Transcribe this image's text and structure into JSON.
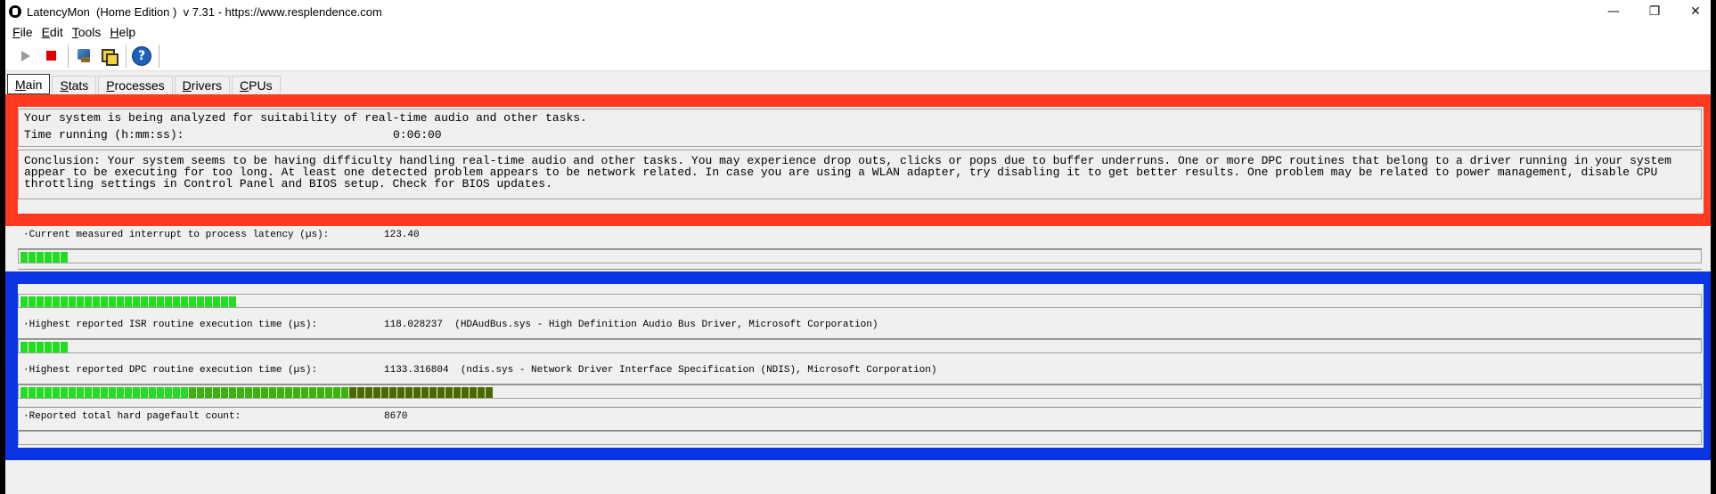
{
  "window": {
    "title": "LatencyMon  (Home Edition )  v 7.31 - https://www.resplendence.com",
    "minimize_glyph": "—",
    "maximize_glyph": "❐",
    "close_glyph": "✕"
  },
  "menu": {
    "file": {
      "accel": "F",
      "rest": "ile"
    },
    "edit": {
      "accel": "E",
      "rest": "dit"
    },
    "tools": {
      "accel": "T",
      "rest": "ools"
    },
    "help": {
      "accel": "H",
      "rest": "elp"
    }
  },
  "toolbar": {
    "icons": [
      "play-icon",
      "stop-icon",
      "analyze-icon",
      "windows-icon",
      "help-icon"
    ],
    "help_glyph": "?"
  },
  "tabs": [
    {
      "accel": "M",
      "rest": "ain",
      "active": true
    },
    {
      "accel": "S",
      "rest": "tats",
      "active": false
    },
    {
      "accel": "P",
      "rest": "rocesses",
      "active": false
    },
    {
      "accel": "D",
      "rest": "rivers",
      "active": false
    },
    {
      "accel": "C",
      "rest": "PUs",
      "active": false
    }
  ],
  "status": {
    "line": "Your system is being analyzed for suitability of real-time audio and other tasks.",
    "time_label": "Time running (h:mm:ss):",
    "time_value": "0:06:00",
    "conclusion": "Conclusion: Your system seems to be having difficulty handling real-time audio and other tasks. You may experience drop outs, clicks or pops due to buffer underruns. One or more DPC routines that belong to a driver running in your system appear to be executing for too long. At least one detected problem appears to be network related. In case you are using a WLAN adapter, try disabling it to get better results. One problem may be related to power management, disable CPU throttling settings in Control Panel and BIOS setup. Check for BIOS updates."
  },
  "metrics": {
    "interrupt": {
      "label": "·Current measured interrupt to process latency (µs):",
      "value": "123.40",
      "bar_segments": 6
    },
    "unlabeled_bar_segments": 27,
    "isr": {
      "label": "·Highest reported ISR routine execution time (µs):",
      "value": "118.028237  (HDAudBus.sys - High Definition Audio Bus Driver, Microsoft Corporation)",
      "bar_segments": 6
    },
    "dpc": {
      "label": "·Highest reported DPC routine execution time (µs):",
      "value": "1133.316804  (ndis.sys - Network Driver Interface Specification (NDIS), Microsoft Corporation)",
      "bar_segments": 59
    },
    "pagefault": {
      "label": "·Reported total hard pagefault count:",
      "value": "8670"
    }
  },
  "colors": {
    "bar_green": "#22dd22",
    "bar_dark_green": "#4a6a00",
    "highlight_red": "#ff3a1f",
    "highlight_blue": "#0a35e6"
  }
}
